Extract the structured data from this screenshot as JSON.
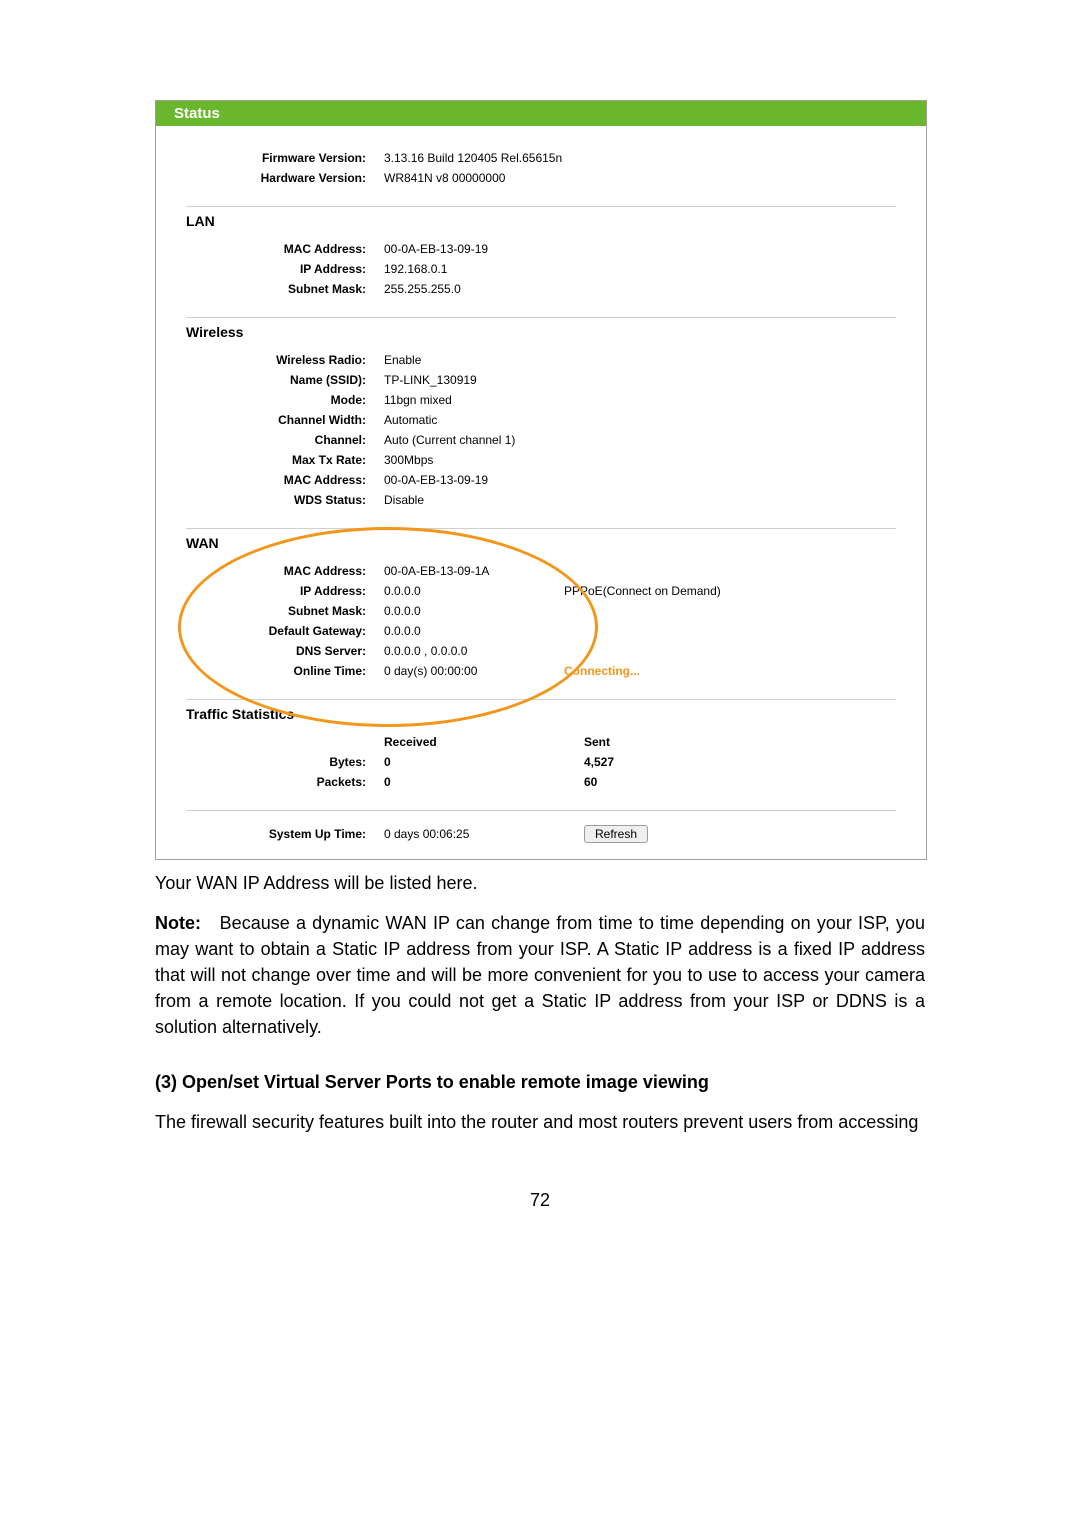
{
  "router": {
    "statusTitle": "Status",
    "version": {
      "firmwareLabel": "Firmware Version:",
      "firmwareValue": "3.13.16 Build 120405 Rel.65615n",
      "hardwareLabel": "Hardware Version:",
      "hardwareValue": "WR841N v8 00000000"
    },
    "lan": {
      "title": "LAN",
      "macLabel": "MAC Address:",
      "macValue": "00-0A-EB-13-09-19",
      "ipLabel": "IP Address:",
      "ipValue": "192.168.0.1",
      "subnetLabel": "Subnet Mask:",
      "subnetValue": "255.255.255.0"
    },
    "wireless": {
      "title": "Wireless",
      "radioLabel": "Wireless Radio:",
      "radioValue": "Enable",
      "ssidLabel": "Name (SSID):",
      "ssidValue": "TP-LINK_130919",
      "modeLabel": "Mode:",
      "modeValue": "11bgn mixed",
      "widthLabel": "Channel Width:",
      "widthValue": "Automatic",
      "channelLabel": "Channel:",
      "channelValue": "Auto (Current channel 1)",
      "txLabel": "Max Tx Rate:",
      "txValue": "300Mbps",
      "macLabel": "MAC Address:",
      "macValue": "00-0A-EB-13-09-19",
      "wdsLabel": "WDS Status:",
      "wdsValue": "Disable"
    },
    "wan": {
      "title": "WAN",
      "macLabel": "MAC Address:",
      "macValue": "00-0A-EB-13-09-1A",
      "ipLabel": "IP Address:",
      "ipValue": "0.0.0.0",
      "ipType": "PPPoE(Connect on Demand)",
      "subnetLabel": "Subnet Mask:",
      "subnetValue": "0.0.0.0",
      "gwLabel": "Default Gateway:",
      "gwValue": "0.0.0.0",
      "dnsLabel": "DNS Server:",
      "dnsValue": "0.0.0.0 , 0.0.0.0",
      "onlineLabel": "Online Time:",
      "onlineValue": "0 day(s) 00:00:00",
      "onlineStatus": "Connecting..."
    },
    "traffic": {
      "title": "Traffic Statistics",
      "recvLabel": "Received",
      "sentLabel": "Sent",
      "bytesLabel": "Bytes:",
      "bytesRecv": "0",
      "bytesSent": "4,527",
      "packetsLabel": "Packets:",
      "packetsRecv": "0",
      "packetsSent": "60"
    },
    "uptime": {
      "label": "System Up Time:",
      "value": "0 days 00:06:25",
      "refreshLabel": "Refresh"
    }
  },
  "doc": {
    "caption": "Your WAN IP Address will be listed here.",
    "noteLabel": "Note:",
    "noteBody": "Because a dynamic WAN IP can change from time to time depending on your ISP, you may want to obtain a Static IP address from your ISP. A Static IP address is a fixed IP address that will not change over time and will be more convenient for you to use to access your camera from a remote location. If you could not get a Static IP address from your ISP or DDNS is a solution alternatively.",
    "heading": "(3) Open/set Virtual Server Ports to enable remote image viewing",
    "body2": "The firewall security features built into the router and most routers prevent users from accessing",
    "pageNumber": "72"
  }
}
